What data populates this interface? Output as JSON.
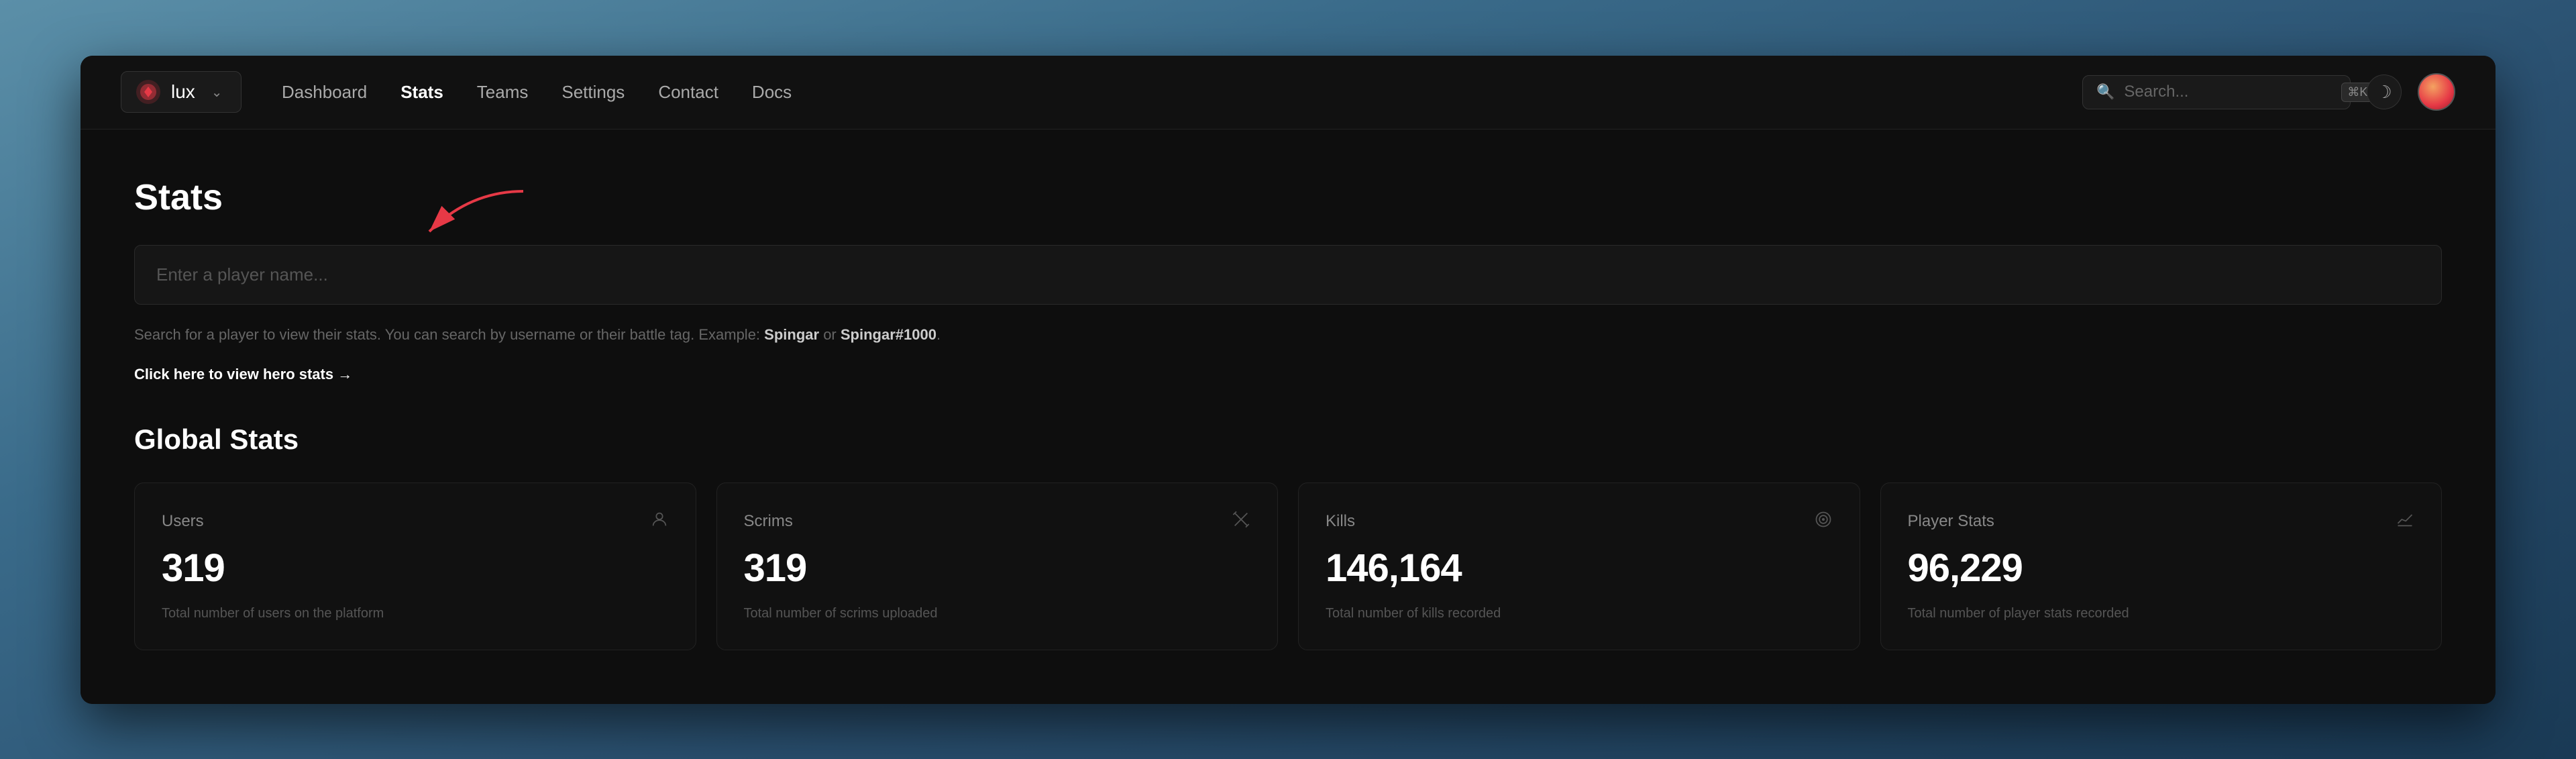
{
  "brand": {
    "name": "lux"
  },
  "nav": {
    "links": [
      {
        "label": "Dashboard",
        "active": false
      },
      {
        "label": "Stats",
        "active": true
      },
      {
        "label": "Teams",
        "active": false
      },
      {
        "label": "Settings",
        "active": false
      },
      {
        "label": "Contact",
        "active": false
      },
      {
        "label": "Docs",
        "active": false
      }
    ]
  },
  "search": {
    "placeholder": "Search...",
    "kbd": "⌘K"
  },
  "page": {
    "title": "Stats",
    "player_search_placeholder": "Enter a player name...",
    "search_hint": "Search for a player to view their stats. You can search by username or their battle tag. Example: ",
    "search_hint_example1": "Spingar",
    "search_hint_or": " or ",
    "search_hint_example2": "Spingar#1000",
    "hero_link": "Click here to view hero stats →",
    "global_stats_title": "Global Stats"
  },
  "stats": [
    {
      "label": "Users",
      "value": "319",
      "desc": "Total number of users on the platform",
      "icon": "person"
    },
    {
      "label": "Scrims",
      "value": "319",
      "desc": "Total number of scrims uploaded",
      "icon": "swords"
    },
    {
      "label": "Kills",
      "value": "146,164",
      "desc": "Total number of kills recorded",
      "icon": "target"
    },
    {
      "label": "Player Stats",
      "value": "96,229",
      "desc": "Total number of player stats recorded",
      "icon": "chart"
    }
  ]
}
